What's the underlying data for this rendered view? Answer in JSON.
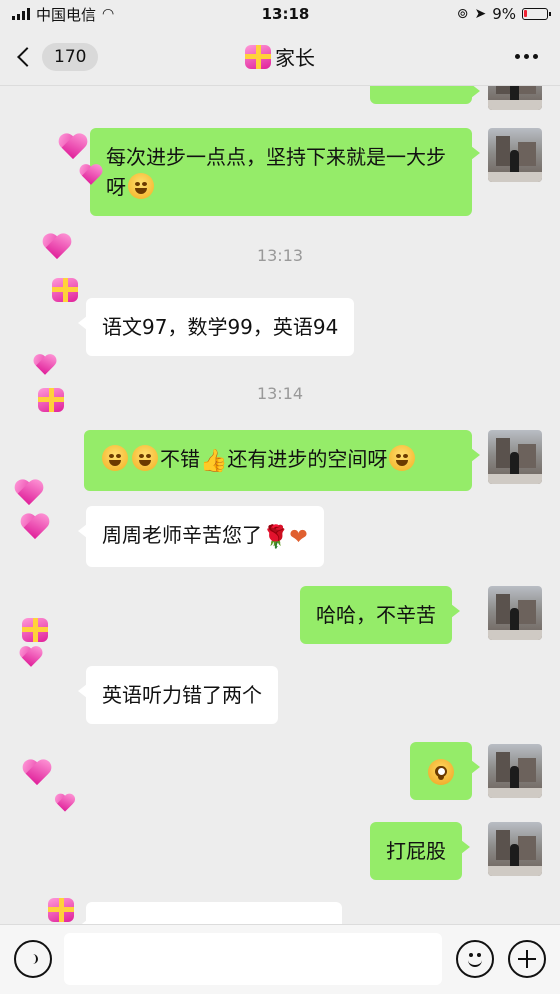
{
  "status_bar": {
    "carrier": "中国电信",
    "time": "13:18",
    "battery": "9%"
  },
  "nav": {
    "unread_count": "170",
    "title": "家长"
  },
  "messages": [
    {
      "side": "right",
      "text": "每次进步一点点，坚持下来就是一大步呀"
    },
    {
      "type": "time",
      "text": "13:13"
    },
    {
      "side": "left",
      "text": "语文97，数学99，英语94"
    },
    {
      "type": "time",
      "text": "13:14"
    },
    {
      "side": "right",
      "text_before": "不错",
      "text_after": "还有进步的空间呀"
    },
    {
      "side": "left",
      "text": "周周老师辛苦您了"
    },
    {
      "side": "right",
      "text": "哈哈，不辛苦"
    },
    {
      "side": "left",
      "text": "英语听力错了两个"
    },
    {
      "side": "right",
      "emoji": "flushed-emoji"
    },
    {
      "side": "right",
      "text": "打屁股"
    }
  ],
  "colors": {
    "outgoing_bubble": "#95ec69",
    "incoming_bubble": "#ffffff",
    "background": "#ededed"
  }
}
